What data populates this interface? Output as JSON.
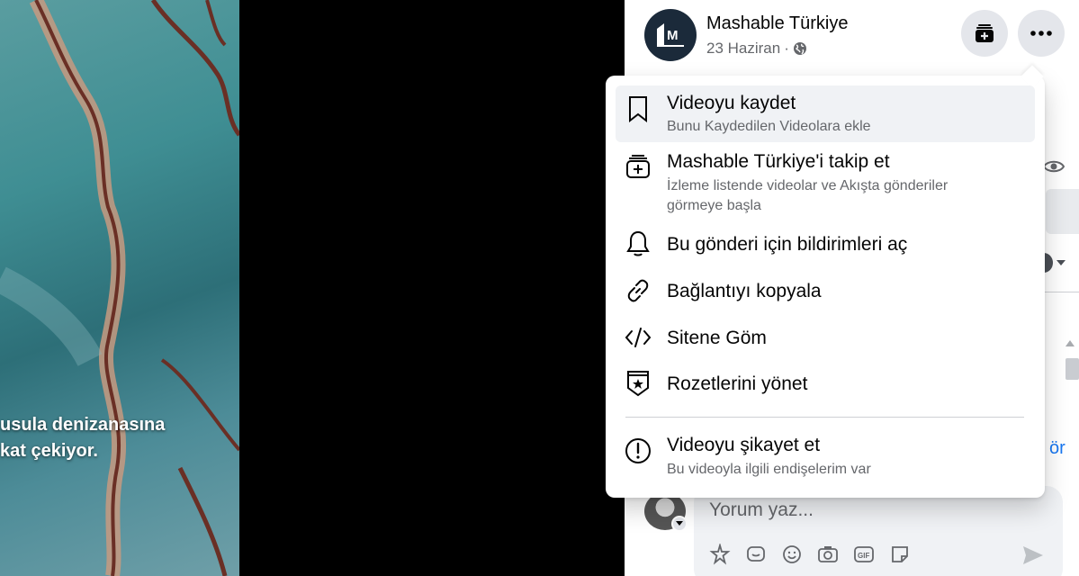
{
  "video": {
    "caption_line1": "usula denizanasına",
    "caption_line2": "kat çekiyor."
  },
  "post": {
    "page_name": "Mashable Türkiye",
    "date": "23 Haziran",
    "separator": "·",
    "avatar_letter": "M"
  },
  "menu": {
    "items": [
      {
        "title": "Videoyu kaydet",
        "subtitle": "Bunu Kaydedilen Videolara ekle",
        "icon": "bookmark-icon"
      },
      {
        "title": "Mashable Türkiye'i takip et",
        "subtitle": "İzleme listende videolar ve Akışta gönderiler görmeye başla",
        "icon": "follow-plus-icon"
      },
      {
        "title": "Bu gönderi için bildirimleri aç",
        "icon": "bell-icon"
      },
      {
        "title": "Bağlantıyı kopyala",
        "icon": "link-icon"
      },
      {
        "title": "Sitene Göm",
        "icon": "code-icon"
      },
      {
        "title": "Rozetlerini yönet",
        "icon": "badge-star-icon"
      },
      {
        "title": "Videoyu şikayet et",
        "subtitle": "Bu videoyla ilgili endişelerim var",
        "icon": "alert-circle-icon"
      }
    ]
  },
  "side": {
    "see_more_fragment": "ör"
  },
  "comment": {
    "placeholder": "Yorum yaz..."
  },
  "colors": {
    "accent": "#1877f2",
    "secondary_text": "#65676b",
    "button_bg": "#e4e6eb"
  }
}
